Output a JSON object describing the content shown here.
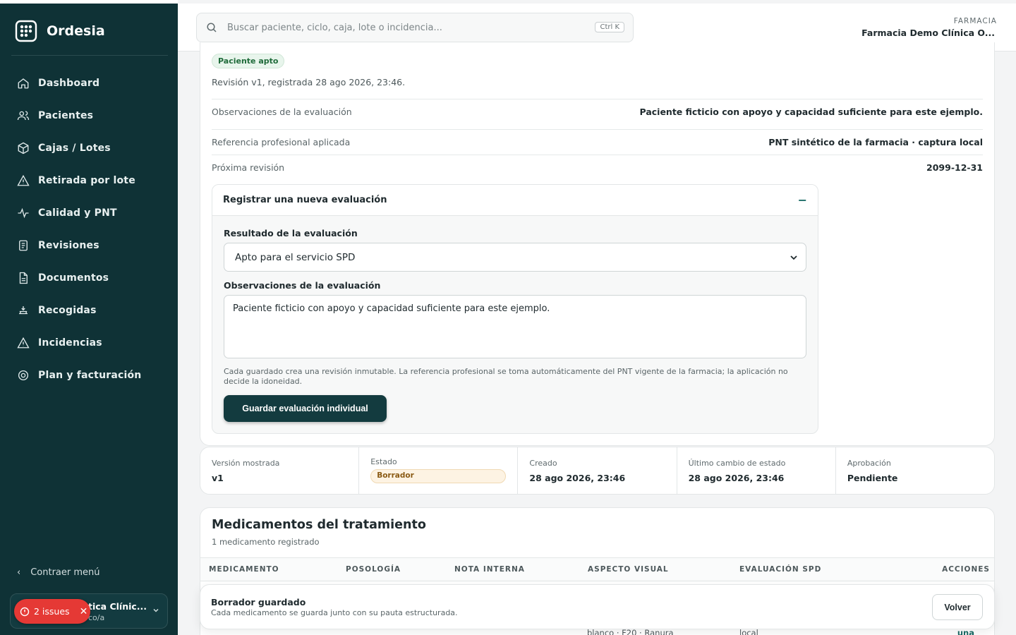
{
  "app": {
    "name": "Ordesia"
  },
  "sidebar": {
    "items": [
      {
        "label": "Dashboard",
        "icon": "home-icon"
      },
      {
        "label": "Pacientes",
        "icon": "users-icon"
      },
      {
        "label": "Cajas / Lotes",
        "icon": "box-icon"
      },
      {
        "label": "Retirada por lote",
        "icon": "alert-triangle-icon"
      },
      {
        "label": "Calidad y PNT",
        "icon": "activity-icon"
      },
      {
        "label": "Revisiones",
        "icon": "clipboard-icon"
      },
      {
        "label": "Documentos",
        "icon": "file-icon"
      },
      {
        "label": "Recogidas",
        "icon": "pickup-icon"
      },
      {
        "label": "Incidencias",
        "icon": "warning-icon"
      },
      {
        "label": "Plan y facturación",
        "icon": "settings-icon"
      }
    ],
    "collapse_label": "Contraer menú",
    "org_name": "tica Clínic...",
    "org_role": "co/a",
    "issues_label": "2 issues"
  },
  "topbar": {
    "search_placeholder": "Buscar paciente, ciclo, caja, lote o incidencia...",
    "shortcut": "Ctrl K",
    "pharmacy_label": "FARMACIA",
    "pharmacy_name": "Farmacia Demo Clínica O..."
  },
  "evaluation": {
    "status_pill": "Paciente apto",
    "revision_text": "Revisión v1, registrada 28 ago 2026, 23:46.",
    "rows": [
      {
        "key": "Observaciones de la evaluación",
        "value": "Paciente ficticio con apoyo y capacidad suficiente para este ejemplo."
      },
      {
        "key": "Referencia profesional aplicada",
        "value": "PNT sintético de la farmacia · captura local"
      },
      {
        "key": "Próxima revisión",
        "value": "2099-12-31"
      }
    ],
    "form": {
      "title": "Registrar una nueva evaluación",
      "toggle": "−",
      "result_label": "Resultado de la evaluación",
      "result_value": "Apto para el servicio SPD",
      "obs_label": "Observaciones de la evaluación",
      "obs_value": "Paciente ficticio con apoyo y capacidad suficiente para este ejemplo.",
      "help": "Cada guardado crea una revisión inmutable. La referencia profesional se toma automáticamente del PNT vigente de la farmacia; la aplicación no decide la idoneidad.",
      "save_label": "Guardar evaluación individual"
    }
  },
  "meta": {
    "version_label": "Versión mostrada",
    "version_value": "v1",
    "state_label": "Estado",
    "state_value": "Borrador",
    "created_label": "Creado",
    "created_value": "28 ago 2026, 23:46",
    "changed_label": "Último cambio de estado",
    "changed_value": "28 ago 2026, 23:46",
    "approval_label": "Aprobación",
    "approval_value": "Pendiente"
  },
  "medications": {
    "title": "Medicamentos del tratamiento",
    "subtitle": "1 medicamento registrado",
    "columns": [
      "MEDICAMENTO",
      "POSOLOGÍA",
      "NOTA INTERNA",
      "ASPECTO VISUAL",
      "EVALUACIÓN SPD",
      "ACCIONES"
    ],
    "peek_visual": "blanco · F20 · Ranura",
    "peek_eval": "local",
    "peek_action": "una"
  },
  "toast": {
    "title": "Borrador guardado",
    "subtitle": "Cada medicamento se guarda junto con su pauta estructurada.",
    "back_label": "Volver"
  },
  "colors": {
    "sidebar": "#0f3236",
    "accent": "#133b3f",
    "danger": "#e53935"
  }
}
